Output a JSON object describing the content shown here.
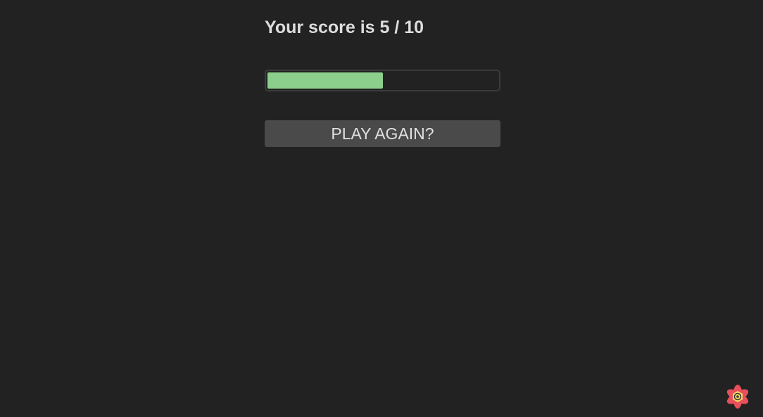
{
  "result": {
    "score_text": "Your score is 5 / 10",
    "score": 5,
    "total": 10,
    "progress_fraction": 0.5
  },
  "actions": {
    "play_again_label": "PLAY AGAIN?"
  },
  "colors": {
    "background": "#222222",
    "progress_fill": "#8ccf8c",
    "progress_border": "#3b3b3b",
    "button_bg": "#4a4a4a",
    "text": "#dddddd"
  },
  "icons": {
    "corner_widget": "devtools-flower-icon"
  }
}
